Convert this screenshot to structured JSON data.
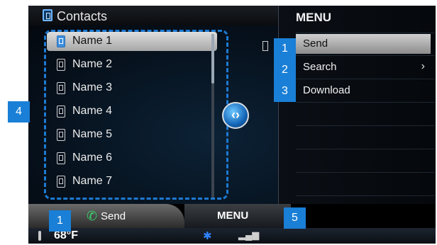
{
  "header": {
    "title": "Contacts"
  },
  "contacts": [
    {
      "label": "Name 1",
      "selected": true
    },
    {
      "label": "Name 2"
    },
    {
      "label": "Name 3"
    },
    {
      "label": "Name 4"
    },
    {
      "label": "Name 5"
    },
    {
      "label": "Name 6"
    },
    {
      "label": "Name 7"
    }
  ],
  "menu": {
    "title": "MENU",
    "items": [
      {
        "label": "Send",
        "selected": true
      },
      {
        "label": "Search",
        "submenu": true
      },
      {
        "label": "Download"
      }
    ]
  },
  "bottom": {
    "send_label": "Send",
    "menu_label": "MENU"
  },
  "status": {
    "temperature": "68°F"
  },
  "callouts": {
    "c1_send": "1",
    "c2_search": "2",
    "c3_download": "3",
    "c4_list": "4",
    "c5_menu": "5",
    "c1_bottom": "1"
  },
  "colors": {
    "accent": "#1a7fd6",
    "selected_row": "#c8c8c8",
    "send_icon": "#36d36a",
    "bluetooth": "#2f82ff"
  },
  "icons": {
    "contacts": "phonebook-icon",
    "knob": "rotary-knob-icon",
    "bluetooth": "bluetooth-icon",
    "signal": "signal-icon",
    "temperature": "thermometer-icon",
    "send": "phone-icon"
  }
}
